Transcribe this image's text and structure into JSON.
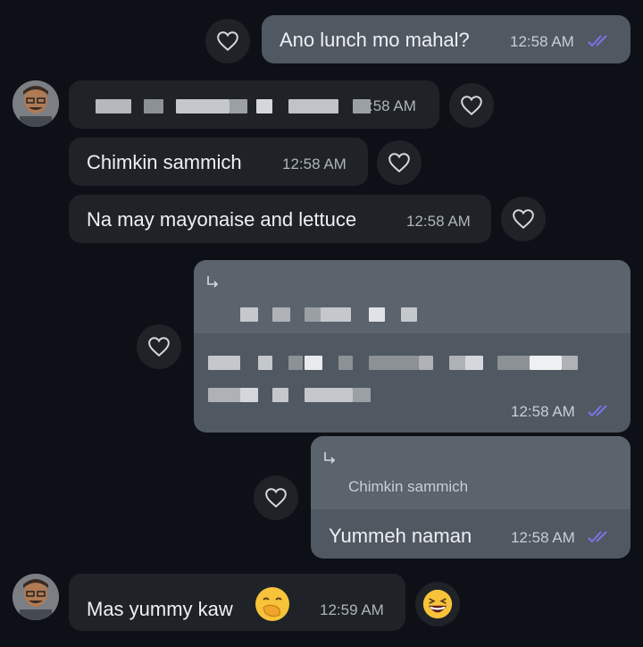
{
  "colors": {
    "bg": "#0d1117",
    "outgoing": "#505862",
    "incoming": "#1f2328",
    "tick": "#7b74e8"
  },
  "messages": {
    "m1": {
      "text": "Ano lunch mo mahal?",
      "time": "12:58 AM"
    },
    "m2": {
      "time": ":58 AM"
    },
    "m3": {
      "text": "Chimkin sammich",
      "time": "12:58 AM"
    },
    "m4": {
      "text": "Na may mayonaise and lettuce",
      "time": "12:58 AM"
    },
    "m5": {
      "time": "12:58 AM"
    },
    "m6": {
      "reply_to": "Chimkin sammich",
      "text": "Yummeh naman",
      "time": "12:58 AM"
    },
    "m7": {
      "text": "Mas yummy kaw",
      "time": "12:59 AM",
      "emoji": "hand-over-mouth-emoji"
    }
  },
  "reaction": {
    "emoji": "grinning-squinting-face-emoji"
  },
  "icons": {
    "heart": "heart-icon",
    "read": "double-check-icon",
    "reply": "reply-arrow-icon",
    "avatar": "user-avatar"
  }
}
